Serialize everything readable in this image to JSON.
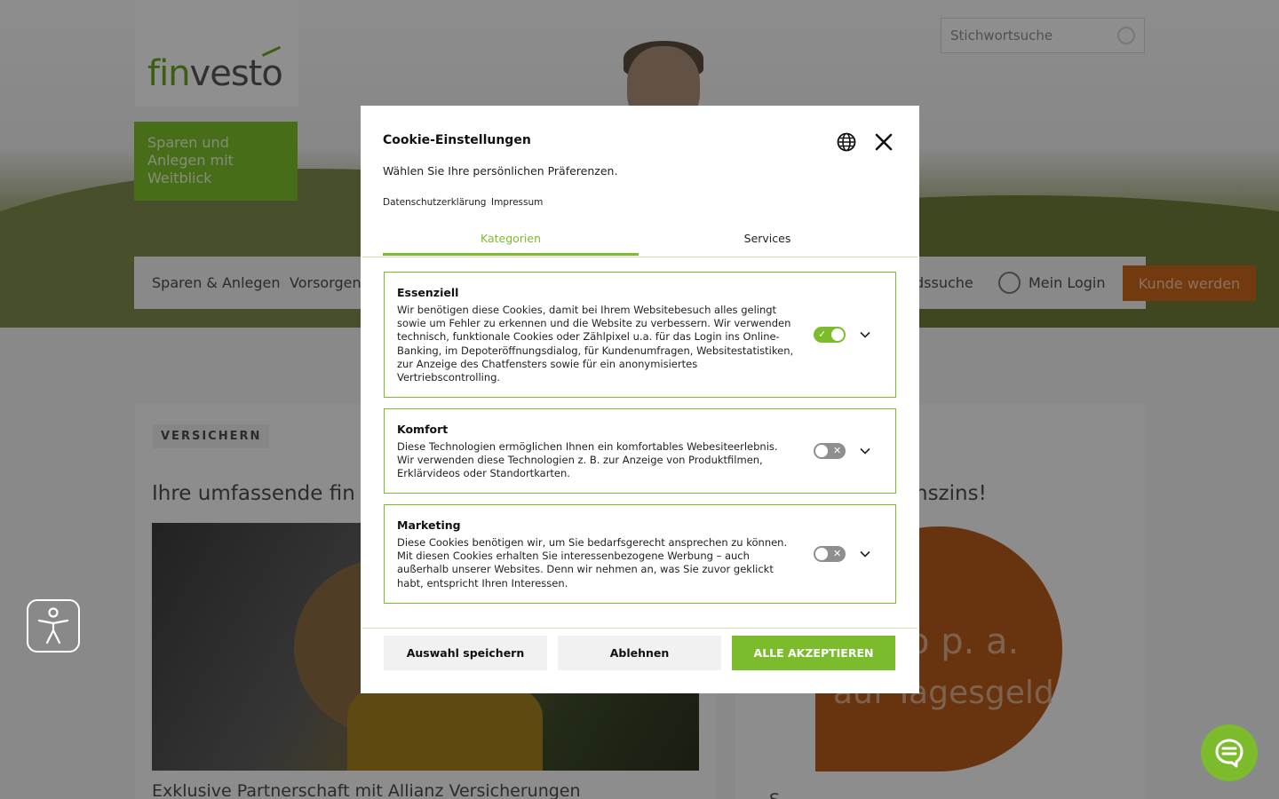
{
  "site": {
    "logo_fin": "fin",
    "logo_vesto": "vesto",
    "slogan_lines": [
      "Sparen und",
      "Anlegen mit",
      "Weitblick"
    ],
    "search_placeholder": "Stichwortsuche",
    "nav": {
      "items": [
        "Sparen & Anlegen",
        "Vorsorgen",
        "dssuche",
        "Mein Login"
      ],
      "cta": "Kunde werden"
    },
    "card_left": {
      "tag": "VERSICHERN",
      "title": "Ihre umfassende fin",
      "bottom": "Exklusive Partnerschaft mit Allianz Versicherungen"
    },
    "card_right": {
      "title": "nszins!",
      "circle_line1": "o p. a.",
      "circle_line2": "auf Tagesgeld",
      "bottom": "S"
    }
  },
  "modal": {
    "title": "Cookie-Einstellungen",
    "subtitle": "Wählen Sie Ihre persönlichen Präferenzen.",
    "links": [
      "Datenschutzerklärung",
      "Impressum"
    ],
    "tabs": [
      "Kategorien",
      "Services"
    ],
    "categories": [
      {
        "title": "Essenziell",
        "description": "Wir benötigen diese Cookies, damit bei Ihrem Websitebesuch alles gelingt sowie um Fehler zu erkennen und die Website zu verbessern. Wir verwenden technisch, funktionale Cookies oder Zählpixel u.a. für das Login ins Online-Banking, im Depoteröffnungsdialog, für Kundenumfragen, Websitestatistiken, zur Anzeige des Chatfensters sowie für ein anonymisiertes Vertriebscontrolling.",
        "enabled": true
      },
      {
        "title": "Komfort",
        "description": "Diese Technologien ermöglichen Ihnen ein komfortables Webesiteerlebnis. Wir verwenden diese Technologien z. B. zur Anzeige von Produktfilmen, Erklärvideos oder Standortkarten.",
        "enabled": false
      },
      {
        "title": "Marketing",
        "description": "Diese Cookies benötigen wir, um Sie bedarfsgerecht ansprechen zu können. Mit diesen Cookies erhalten Sie interessenbezogene Werbung – auch außerhalb unserer Websites. Denn wir nehmen an, was Sie zuvor geklickt habt, entspricht Ihren Interessen.",
        "enabled": false
      }
    ],
    "buttons": {
      "save": "Auswahl speichern",
      "deny": "Ablehnen",
      "accept_all": "ALLE AKZEPTIEREN"
    },
    "toggle_marks": {
      "on": "✓",
      "off": "✕"
    }
  },
  "colors": {
    "brand_green": "#7cbc2c",
    "cta_orange": "#c8651a",
    "toggle_off": "#8f8f8f"
  },
  "icons": [
    "globe-icon",
    "close-icon",
    "chevron-down-icon",
    "accessibility-icon",
    "chat-icon",
    "user-circle-icon",
    "search-icon"
  ]
}
